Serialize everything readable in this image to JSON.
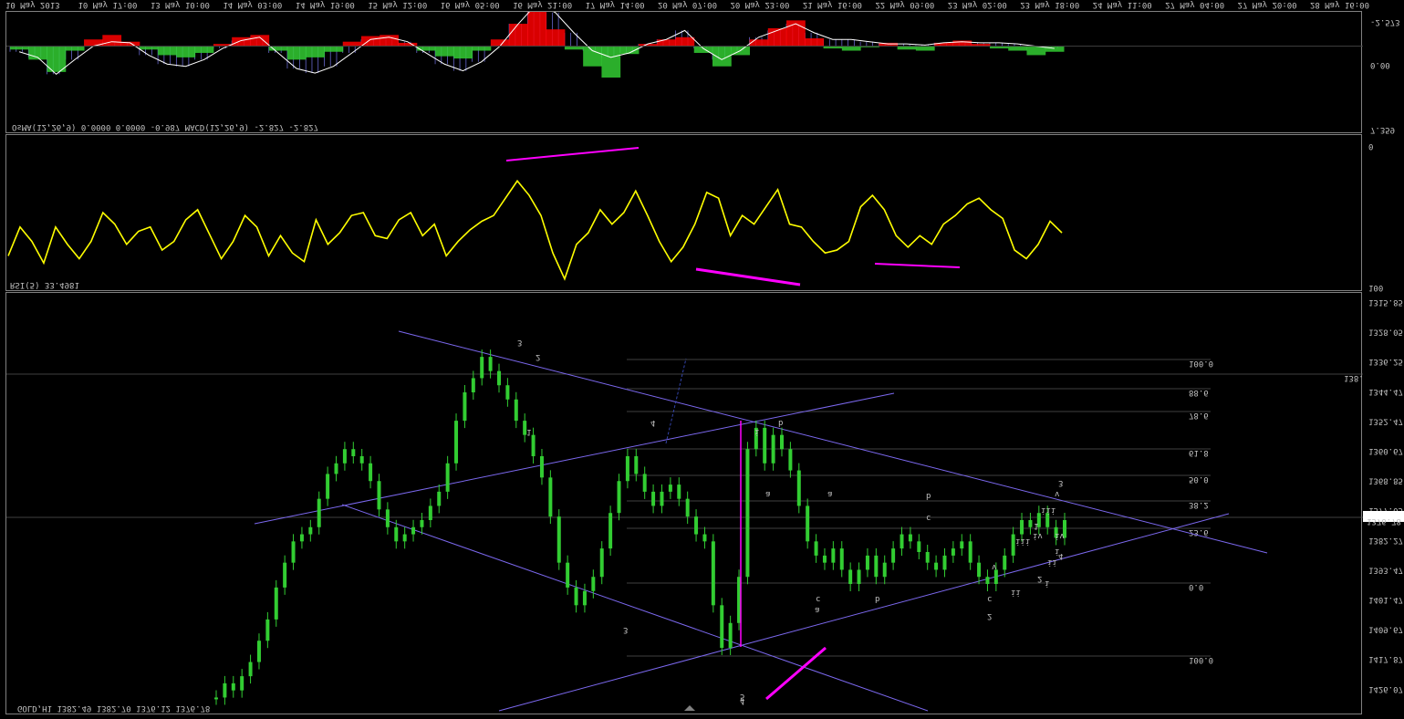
{
  "time_axis": {
    "labels": [
      "10 May 2013",
      "10 May 17:00",
      "13 May 10:00",
      "14 May 03:00",
      "14 May 19:00",
      "15 May 12:00",
      "16 May 05:00",
      "16 May 21:00",
      "17 May 14:00",
      "20 May 07:00",
      "20 May 23:00",
      "21 May 16:00",
      "22 May 09:00",
      "23 May 02:00",
      "23 May 18:00",
      "24 May 11:00",
      "27 May 04:00",
      "27 May 20:00",
      "28 May 16:00"
    ]
  },
  "macd_pane": {
    "label": "OsMA(12,26,9) 0.0000 0.0000 -0.987  MACD(12,26,9) -2.827 -2.827",
    "scale": [
      "-2.573",
      "0.00",
      "7.359"
    ]
  },
  "rsi_pane": {
    "label": "RSI(5) 33.4981",
    "scale": [
      "0",
      "100"
    ]
  },
  "price_pane": {
    "label": "GOLD,H1  1382.49 1382.70 1376.12 1376.78",
    "price_scale": [
      "1315.85",
      "1328.05",
      "1336.25",
      "1344.47",
      "1352.47",
      "1360.67",
      "1368.85",
      "1377.05",
      "1382.27",
      "1393.47",
      "1401.47",
      "1409.67",
      "1417.87",
      "1426.07"
    ],
    "current_price": "1376.78",
    "fib_labels": [
      "100.0",
      "88.6",
      "78.6",
      "61.8",
      "50.0",
      "38.2",
      "23.6",
      "0.0",
      "100.0"
    ],
    "fib_right_label": "138.2",
    "wave_labels": [
      {
        "t": "3",
        "c": "#ff4500"
      },
      {
        "t": "2",
        "c": "#9acd32"
      },
      {
        "t": "1",
        "c": "#9acd32"
      },
      {
        "t": "4",
        "c": "#9acd32"
      },
      {
        "t": "3",
        "c": "#9acd32"
      },
      {
        "t": "5",
        "c": "#9acd32"
      },
      {
        "t": "4",
        "c": "#ff4500"
      },
      {
        "t": "i",
        "c": "#ff00ff"
      },
      {
        "t": "b",
        "c": "#4682b4"
      },
      {
        "t": "a",
        "c": "#4682b4"
      },
      {
        "t": "a",
        "c": "#4682b4"
      },
      {
        "t": "c",
        "c": "#4682b4"
      },
      {
        "t": "a",
        "c": "#00bfff"
      },
      {
        "t": "b",
        "c": "#4682b4"
      },
      {
        "t": "b",
        "c": "#00bfff"
      },
      {
        "t": "c",
        "c": "#4682b4"
      },
      {
        "t": "c",
        "c": "#00bfff"
      },
      {
        "t": "2",
        "c": "#ff00ff"
      },
      {
        "t": "3",
        "c": "#ff4500"
      },
      {
        "t": "4",
        "c": "#ff4500"
      },
      {
        "t": "2",
        "c": "#ff4500"
      },
      {
        "t": "1",
        "c": "#ff4500"
      },
      {
        "t": "iii",
        "c": "#c0c0c0"
      },
      {
        "t": "v",
        "c": "#c0c0c0"
      },
      {
        "t": "iv",
        "c": "#c0c0c0"
      },
      {
        "t": "ii",
        "c": "#c0c0c0"
      },
      {
        "t": "i",
        "c": "#c0c0c0"
      },
      {
        "t": "iii",
        "c": "#c0c0c0"
      },
      {
        "t": "iv",
        "c": "#c0c0c0"
      },
      {
        "t": "v",
        "c": "#c0c0c0"
      },
      {
        "t": "ii",
        "c": "#c0c0c0"
      },
      {
        "t": "i",
        "c": "#c0c0c0"
      }
    ]
  },
  "colors": {
    "bull_bar": "#32cd32",
    "hist_red": "#ff0000",
    "hist_green": "#32cd32",
    "macd_line": "#ffffff",
    "macd_signal": "#6666cc",
    "rsi": "#ffff00",
    "divergence": "#ff00ff",
    "trend": "#7b68ee",
    "fib": "#404040"
  },
  "chart_data": [
    {
      "type": "bar",
      "title": "OsMA(12,26,9) 0.0000 0.0000 -0.987  MACD(12,26,9) -2.827 -2.827",
      "ylim": [
        -2.573,
        7.359
      ],
      "series": [
        {
          "name": "OsMA",
          "values": [
            0.3,
            1.2,
            2.3,
            0.4,
            -0.6,
            -1.0,
            -0.4,
            0.3,
            0.8,
            1.0,
            0.6,
            -0.2,
            -0.8,
            -1.0,
            0.4,
            1.2,
            1.0,
            0.5,
            -0.4,
            -0.9,
            -1.0,
            -0.3,
            0.4,
            0.9,
            1.1,
            0.4,
            -0.6,
            -2.0,
            -3.8,
            -1.5,
            0.3,
            1.8,
            2.8,
            0.7,
            -0.2,
            -0.6,
            -0.8,
            0.6,
            1.8,
            0.8,
            -0.6,
            -1.6,
            -2.3,
            -0.7,
            0.2,
            0.4,
            0.1,
            -0.3,
            0.3,
            0.4,
            -0.3,
            -0.5,
            -0.2,
            0.2,
            0.4,
            0.8,
            0.5
          ]
        },
        {
          "name": "MACD",
          "values": [
            0.5,
            1.0,
            2.5,
            1.2,
            0.0,
            -0.4,
            -0.3,
            0.8,
            1.6,
            1.8,
            1.2,
            0.2,
            -0.5,
            -0.8,
            0.6,
            2.0,
            2.4,
            1.8,
            0.6,
            -0.6,
            -0.8,
            -0.4,
            0.6,
            1.6,
            2.2,
            1.4,
            0.0,
            -2.0,
            -3.8,
            -3.0,
            -1.2,
            0.4,
            1.0,
            0.6,
            -0.2,
            -0.6,
            -1.4,
            0.2,
            1.2,
            0.4,
            -0.8,
            -1.4,
            -2.0,
            -1.2,
            -0.6,
            -0.6,
            -0.4,
            -0.2,
            -0.2,
            -0.1,
            -0.3,
            -0.4,
            -0.3,
            -0.3,
            -0.2,
            0.0,
            0.2
          ]
        }
      ]
    },
    {
      "type": "line",
      "title": "RSI(5) 33.4981",
      "ylim": [
        100,
        0
      ],
      "series": [
        {
          "name": "RSI",
          "values": [
            80,
            60,
            70,
            85,
            60,
            72,
            82,
            70,
            50,
            58,
            72,
            63,
            60,
            76,
            70,
            55,
            48,
            65,
            82,
            70,
            52,
            60,
            80,
            66,
            78,
            84,
            55,
            72,
            64,
            52,
            50,
            66,
            68,
            55,
            50,
            66,
            58,
            80,
            70,
            62,
            56,
            52,
            40,
            28,
            38,
            52,
            78,
            96,
            72,
            64,
            48,
            58,
            50,
            35,
            52,
            70,
            84,
            74,
            58,
            36,
            40,
            66,
            52,
            58,
            46,
            34,
            58,
            60,
            70,
            78,
            76,
            70,
            46,
            38,
            48,
            66,
            74,
            66,
            72,
            58,
            52,
            44,
            40,
            48,
            54,
            76,
            82,
            72,
            56,
            64
          ]
        }
      ]
    },
    {
      "type": "line",
      "title": "GOLD,H1  1382.49 1382.70 1376.12 1376.78",
      "ylim": [
        1313.0,
        1430.0
      ],
      "series": [
        {
          "name": "GOLD,H1",
          "values": [
            1426,
            1422,
            1424,
            1420,
            1416,
            1410,
            1404,
            1395,
            1388,
            1382,
            1380,
            1378,
            1370,
            1363,
            1360,
            1356,
            1358,
            1360,
            1365,
            1373,
            1378,
            1382,
            1380,
            1378,
            1376,
            1372,
            1368,
            1360,
            1348,
            1340,
            1336,
            1330,
            1334,
            1338,
            1342,
            1348,
            1352,
            1358,
            1364,
            1375,
            1388,
            1395,
            1400,
            1396,
            1392,
            1384,
            1374,
            1365,
            1358,
            1363,
            1368,
            1372,
            1368,
            1366,
            1370,
            1375,
            1380,
            1382,
            1400,
            1412,
            1405,
            1392,
            1356,
            1350,
            1360,
            1352,
            1356,
            1362,
            1372,
            1382,
            1386,
            1388,
            1384,
            1390,
            1394,
            1390,
            1386,
            1392,
            1388,
            1384,
            1380,
            1382,
            1385,
            1388,
            1390,
            1386,
            1384,
            1382,
            1388,
            1392,
            1394,
            1390,
            1386,
            1380,
            1376,
            1378,
            1374,
            1378,
            1381,
            1376
          ]
        }
      ]
    }
  ]
}
